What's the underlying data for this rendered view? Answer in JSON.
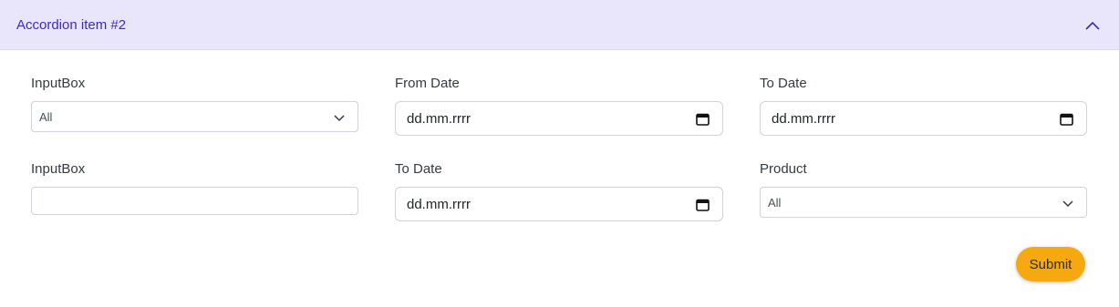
{
  "accordion": {
    "title": "Accordion item #2",
    "toggle_icon": "chevron-up-icon"
  },
  "form": {
    "row1": {
      "col1": {
        "label": "InputBox",
        "type": "select",
        "value": "All"
      },
      "col2": {
        "label": "From Date",
        "type": "date",
        "value": "dd.mm.rrrr",
        "icon": "calendar-icon"
      },
      "col3": {
        "label": "To Date",
        "type": "date",
        "value": "dd.mm.rrrr",
        "icon": "calendar-icon"
      }
    },
    "row2": {
      "col1": {
        "label": "InputBox",
        "type": "text",
        "value": ""
      },
      "col2": {
        "label": "To Date",
        "type": "date",
        "value": "dd.mm.rrrr",
        "icon": "calendar-icon"
      },
      "col3": {
        "label": "Product",
        "type": "select",
        "value": "All"
      }
    },
    "submit_label": "Submit"
  },
  "colors": {
    "header_bg": "#e9e6fb",
    "header_text": "#3d2bbf",
    "submit_bg": "#f5a90f"
  }
}
